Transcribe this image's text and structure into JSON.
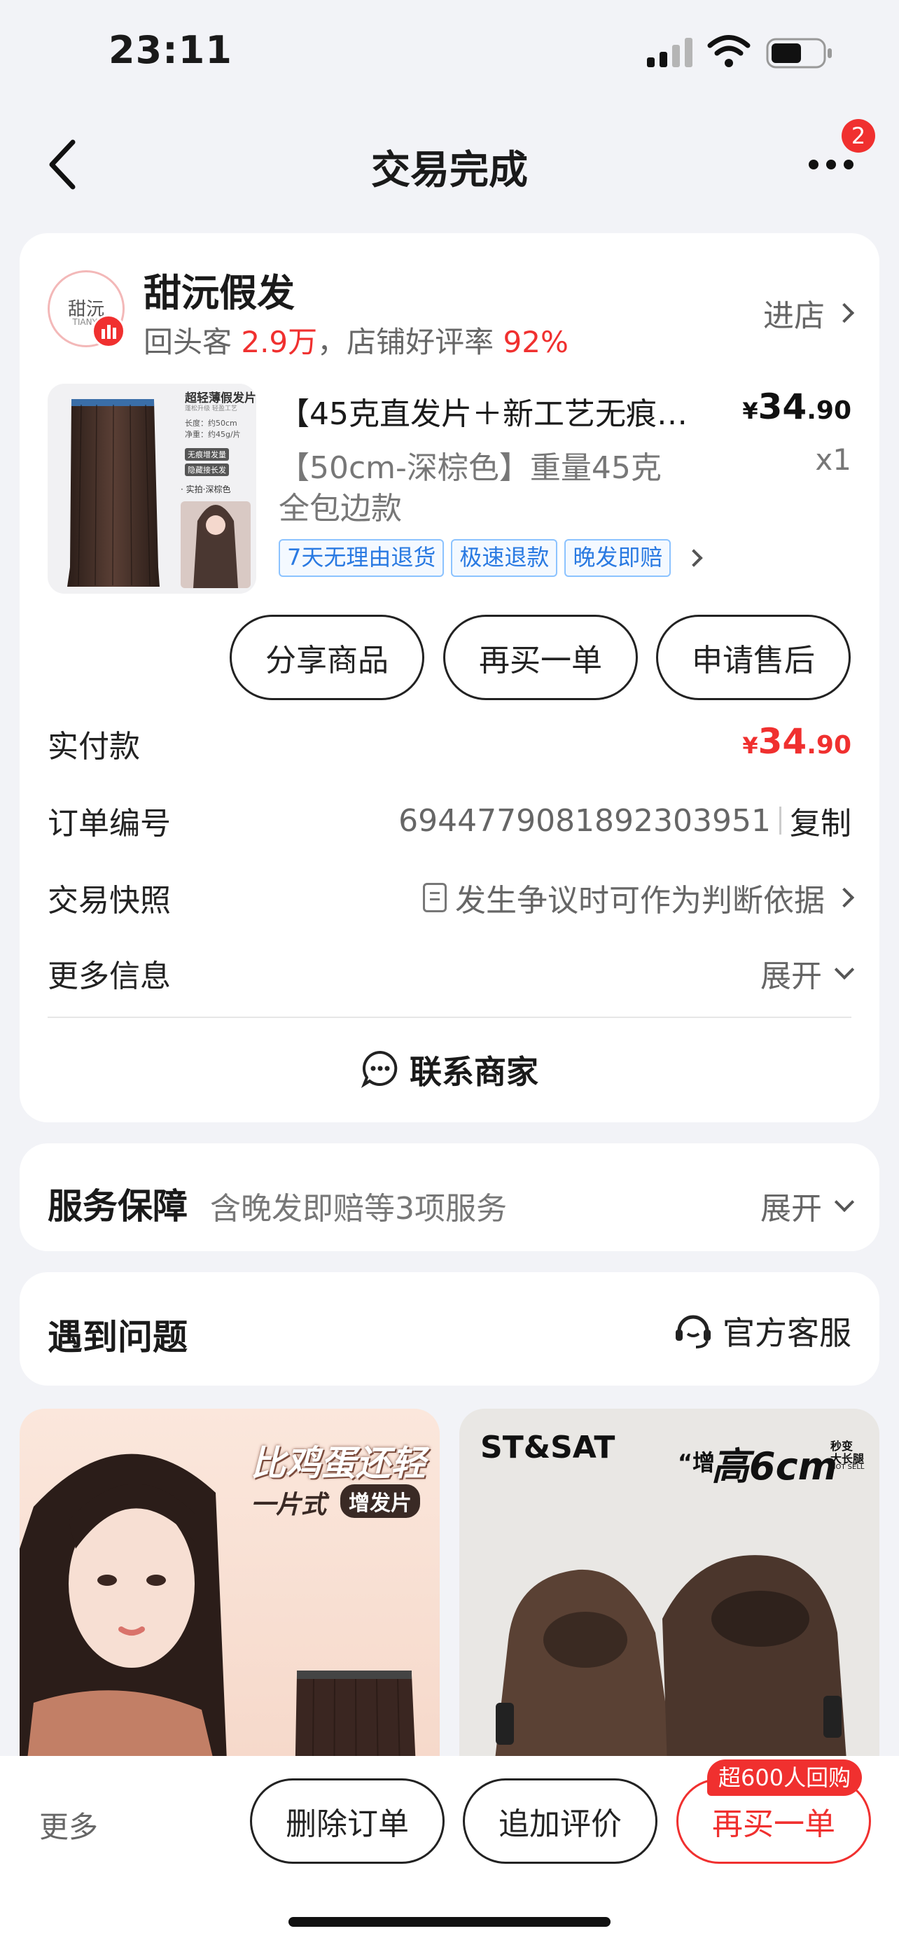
{
  "status_bar": {
    "time": "23:11"
  },
  "nav": {
    "title": "交易完成",
    "more_badge": "2"
  },
  "shop": {
    "logo_text": "甜沅",
    "logo_sub": "TIANYI",
    "name": "甜沅假发",
    "stats_prefix": "回头客 ",
    "repeat_customers": "2.9万",
    "stats_mid": "，店铺好评率 ",
    "rating": "92%",
    "enter_label": "进店"
  },
  "product": {
    "title": "【45克直发片＋新工艺无痕…",
    "price_symbol": "¥",
    "price_int": "34",
    "price_dec": ".90",
    "spec": "【50cm-深棕色】重量45克",
    "spec2": "全包边款",
    "qty": "x1",
    "tags": [
      "7天无理由退货",
      "极速退款",
      "晚发即赔"
    ],
    "img_title": "超轻薄假发片",
    "img_sub": "蓬松升级 轻盈工艺",
    "img_len": "长度：约50cm",
    "img_weight": "净重：约45g/片",
    "img_chk1": "无痕增发量",
    "img_chk2": "隐藏接长发",
    "img_color": "· 实拍·深棕色"
  },
  "actions": {
    "share": "分享商品",
    "rebuy": "再买一单",
    "after_sale": "申请售后"
  },
  "order": {
    "paid_label": "实付款",
    "paid_symbol": "¥",
    "paid_int": "34",
    "paid_dec": ".90",
    "number_label": "订单编号",
    "number": "6944779081892303951",
    "copy_label": "复制",
    "snapshot_label": "交易快照",
    "snapshot_value": "发生争议时可作为判断依据",
    "more_label": "更多信息",
    "expand_label": "展开",
    "contact_label": "联系商家"
  },
  "service": {
    "title": "服务保障",
    "desc": "含晚发即赔等3项服务",
    "expand_label": "展开"
  },
  "problem": {
    "title": "遇到问题",
    "official_label": "官方客服"
  },
  "recommend": {
    "left_line1": "比鸡蛋还轻",
    "left_line2": "一片式",
    "left_badge": "增发片",
    "right_brand": "ST&SAT",
    "right_quote": "“增",
    "right_slogan": "高6cm",
    "right_small1": "秒变",
    "right_small2": "大长腿",
    "right_small3": "HOT SELL"
  },
  "bottom_bar": {
    "more_label": "更多",
    "delete_label": "删除订单",
    "review_label": "追加评价",
    "rebuy_label": "再买一单",
    "rebuy_badge": "超600人回购"
  },
  "colors": {
    "accent_red": "#f0302f",
    "tag_blue": "#2a7ae2",
    "background": "#f2f3f7"
  }
}
